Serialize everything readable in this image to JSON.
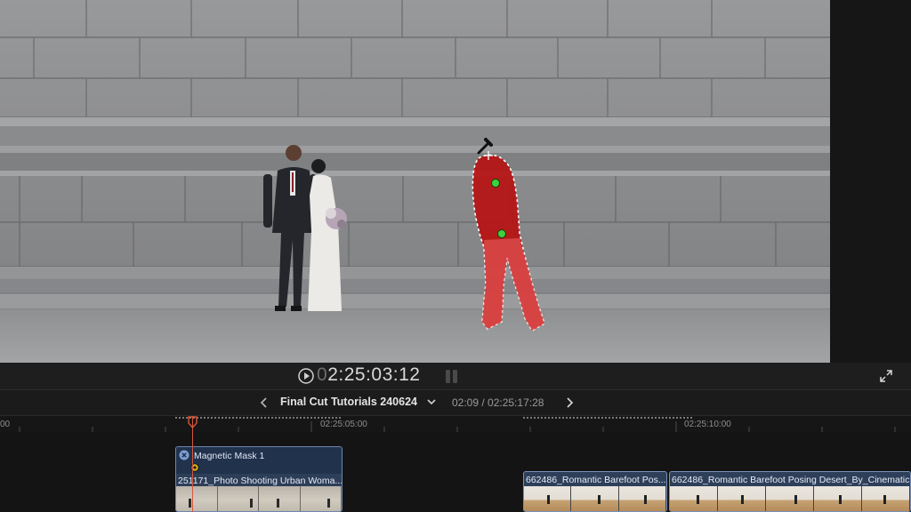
{
  "viewer": {
    "timecode_dim": "0",
    "timecode": "2:25:03:12"
  },
  "timeline_header": {
    "project_name": "Final Cut Tutorials 240624",
    "duration": "02:09 / 02:25:17:28"
  },
  "ruler": {
    "labels": [
      "00",
      "02:25:05:00",
      "02:25:10:00"
    ]
  },
  "clips": {
    "main": {
      "effect_label": "Magnetic Mask 1",
      "name": "251171_Photo Shooting Urban Woma..."
    },
    "b": {
      "name": "662486_Romantic Barefoot Pos..."
    },
    "c": {
      "name": "662486_Romantic Barefoot Posing Desert_By_Cinematic..."
    }
  },
  "colors": {
    "accent_playhead": "#d5573b",
    "mask_overlay": "#c41414",
    "mask_marker": "#3cd23c",
    "clip_blue": "#2d3e58"
  },
  "icons": [
    "play-icon",
    "audio-meter-icon",
    "fullscreen-icon",
    "chevron-left-icon",
    "chevron-down-icon",
    "chevron-right-icon",
    "close-circle-icon",
    "keyframe-icon",
    "eyedropper-icon"
  ]
}
